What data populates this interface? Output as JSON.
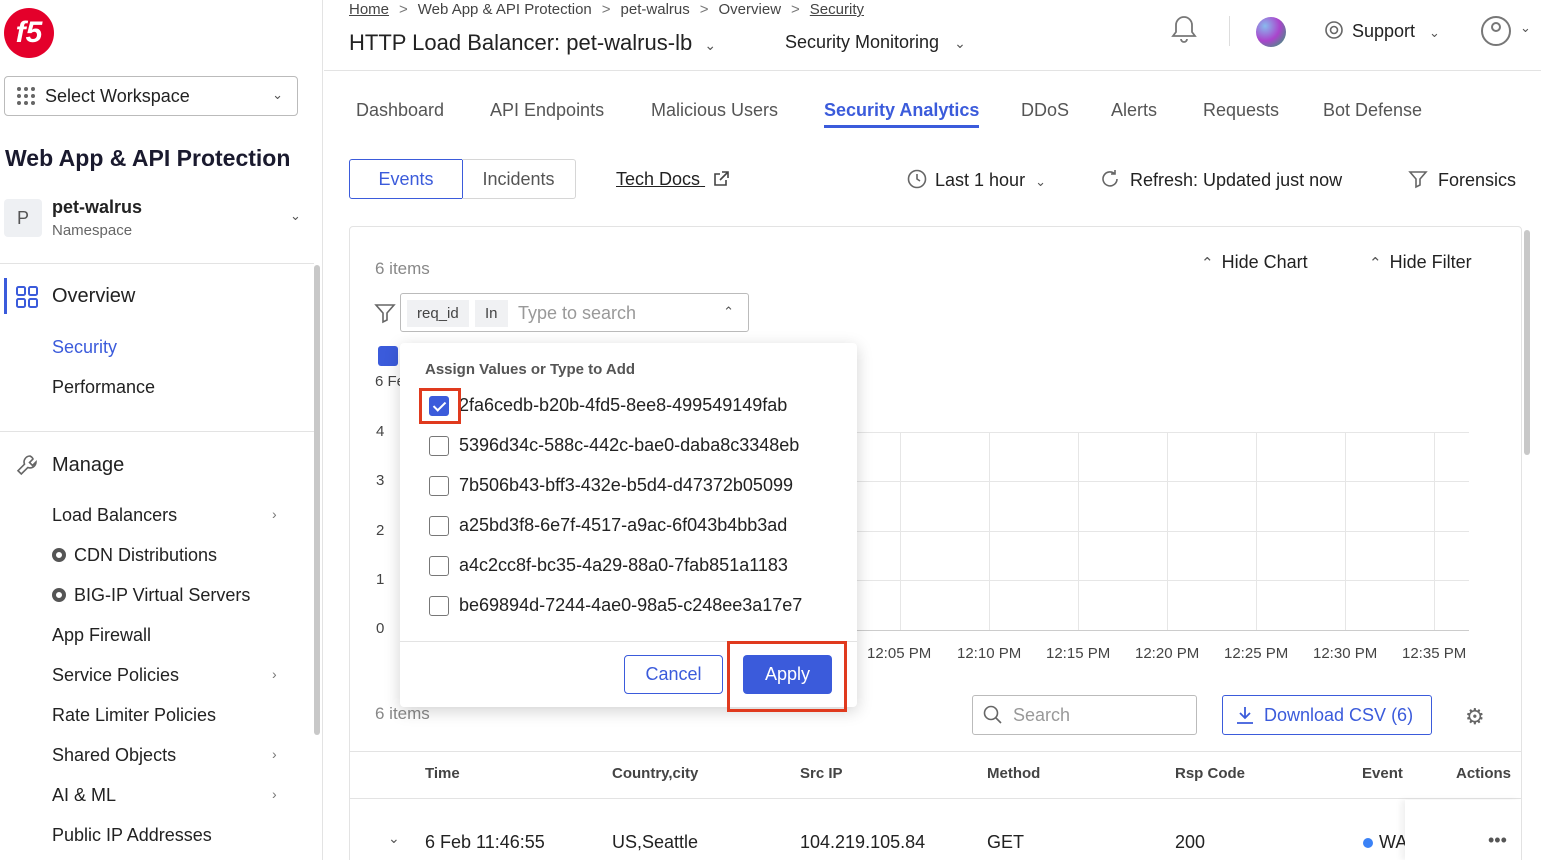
{
  "sidebar": {
    "logo": "f5",
    "workspace_select": "Select Workspace",
    "app_title": "Web App & API Protection",
    "namespace": {
      "avatar": "P",
      "name": "pet-walrus",
      "label": "Namespace"
    },
    "overview": {
      "label": "Overview",
      "items": [
        "Security",
        "Performance"
      ],
      "active": "Security"
    },
    "manage": {
      "label": "Manage",
      "items": [
        "Load Balancers",
        "CDN Distributions",
        "BIG-IP Virtual Servers",
        "App Firewall",
        "Service Policies",
        "Rate Limiter Policies",
        "Shared Objects",
        "AI & ML",
        "Public IP Addresses"
      ]
    }
  },
  "header": {
    "breadcrumb": [
      "Home",
      "Web App & API Protection",
      "pet-walrus",
      "Overview",
      "Security"
    ],
    "lb_title": "HTTP Load Balancer: pet-walrus-lb",
    "monitor_title": "Security Monitoring",
    "support": "Support"
  },
  "tabs": [
    "Dashboard",
    "API Endpoints",
    "Malicious Users",
    "Security Analytics",
    "DDoS",
    "Alerts",
    "Requests",
    "Bot Defense"
  ],
  "active_tab": "Security Analytics",
  "toolbar": {
    "seg_events": "Events",
    "seg_incidents": "Incidents",
    "tech_docs": "Tech Docs",
    "time_range": "Last 1 hour",
    "refresh": "Refresh: Updated just now",
    "forensics": "Forensics"
  },
  "panel": {
    "items_count": "6 items",
    "hide_chart": "Hide Chart",
    "hide_filter": "Hide Filter",
    "filter": {
      "key": "req_id",
      "op": "In",
      "placeholder": "Type to search"
    },
    "partial_label": "6 Fe"
  },
  "chart": {
    "y_ticks": [
      "4",
      "3",
      "2",
      "1",
      "0"
    ],
    "x_ticks": [
      "12:05 PM",
      "12:10 PM",
      "12:15 PM",
      "12:20 PM",
      "12:25 PM",
      "12:30 PM",
      "12:35 PM"
    ]
  },
  "popover": {
    "title": "Assign Values or Type to Add",
    "options": [
      {
        "label": "2fa6cedb-b20b-4fd5-8ee8-499549149fab",
        "checked": true
      },
      {
        "label": "5396d34c-588c-442c-bae0-daba8c3348eb",
        "checked": false
      },
      {
        "label": "7b506b43-bff3-432e-b5d4-d47372b05099",
        "checked": false
      },
      {
        "label": "a25bd3f8-6e7f-4517-a9ac-6f043b4bb3ad",
        "checked": false
      },
      {
        "label": "a4c2cc8f-bc35-4a29-88a0-7fab851a1183",
        "checked": false
      },
      {
        "label": "be69894d-7244-4ae0-98a5-c248ee3a17e7",
        "checked": false
      }
    ],
    "cancel": "Cancel",
    "apply": "Apply"
  },
  "table_bar": {
    "items_count": "6 items",
    "search_placeholder": "Search",
    "download": "Download CSV (6)"
  },
  "table": {
    "columns": [
      "Time",
      "Country,city",
      "Src IP",
      "Method",
      "Rsp Code",
      "Event",
      "Actions"
    ],
    "row": {
      "time": "6 Feb 11:46:55",
      "country": "US,Seattle",
      "ip": "104.219.105.84",
      "method": "GET",
      "code": "200",
      "event": "WA",
      "actions": "•••"
    }
  },
  "colors": {
    "accent": "#3b5bdb",
    "highlight": "#e03a1e",
    "brand": "#e4002b"
  }
}
